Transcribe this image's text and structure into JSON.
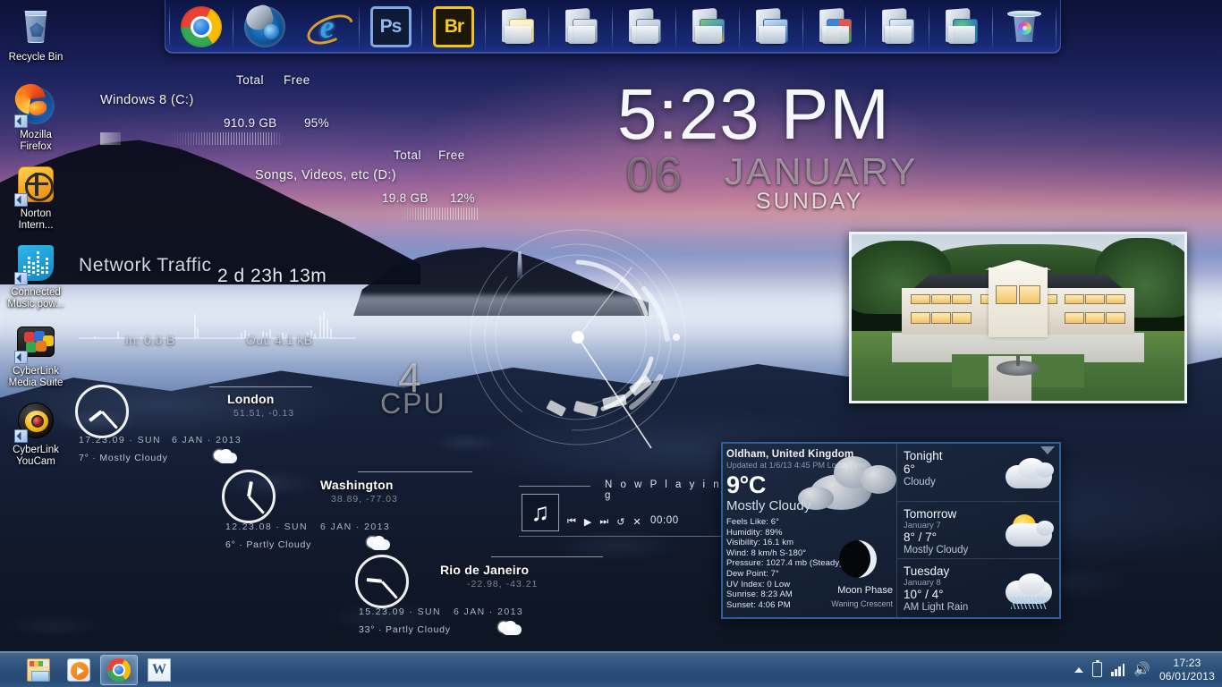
{
  "desktop_icons": [
    {
      "name": "recycle-bin",
      "label": "Recycle Bin"
    },
    {
      "name": "mozilla-firefox",
      "label": "Mozilla\nFirefox"
    },
    {
      "name": "norton-internet",
      "label": "Norton\nIntern..."
    },
    {
      "name": "connected-music",
      "label": "Connected\nMusic pow..."
    },
    {
      "name": "cyberlink-media",
      "label": "CyberLink\nMedia Suite"
    },
    {
      "name": "cyberlink-youcam",
      "label": "CyberLink\nYouCam"
    }
  ],
  "dock": {
    "items": [
      {
        "name": "google-chrome",
        "icon": "chrome-icon"
      },
      {
        "name": "media-player",
        "icon": "dragon-icon"
      },
      {
        "name": "internet-explorer",
        "icon": "ie-icon",
        "label": "e"
      },
      {
        "name": "adobe-photoshop",
        "icon": "photoshop-icon",
        "label": "Ps"
      },
      {
        "name": "adobe-bridge",
        "icon": "bridge-icon",
        "label": "Br"
      },
      {
        "name": "documents-folder",
        "icon": "folder-documents-icon"
      },
      {
        "name": "printers-folder",
        "icon": "folder-printers-icon"
      },
      {
        "name": "devices-folder",
        "icon": "folder-devices-icon"
      },
      {
        "name": "pictures-folder",
        "icon": "folder-pictures-icon"
      },
      {
        "name": "computer-folder",
        "icon": "folder-computer-icon"
      },
      {
        "name": "programs-folder",
        "icon": "folder-programs-icon"
      },
      {
        "name": "control-panel-folder",
        "icon": "folder-controlpanel-icon"
      },
      {
        "name": "network-folder",
        "icon": "folder-network-icon"
      },
      {
        "name": "recycle-bin-dock",
        "icon": "recycle-bin-icon"
      }
    ]
  },
  "disks": [
    {
      "name": "disk-c",
      "label": "Windows 8 (C:)",
      "total_header": "Total",
      "free_header": "Free",
      "total": "910.9 GB",
      "free_pct": "95%",
      "fill_percent": 8
    },
    {
      "name": "disk-d",
      "label": "Songs, Videos, etc (D:)",
      "total_header": "Total",
      "free_header": "Free",
      "total": "19.8 GB",
      "free_pct": "12%",
      "fill_percent": 86
    }
  ],
  "network": {
    "title": "Network Traffic",
    "uptime": "2 d 23h 13m",
    "in": "In: 0.0 B",
    "out": "Out: 4.1 kB"
  },
  "clock": {
    "time": "5:23 PM",
    "day": "06",
    "month": "JANUARY",
    "weekday": "SUNDAY"
  },
  "cpu": {
    "cores": "4",
    "label": "CPU"
  },
  "world_clocks": [
    {
      "name": "london",
      "city": "London",
      "coords": "51.51, -0.13",
      "time_line": "17.23.09  ·  SUN",
      "date_line": "6 JAN  ·  2013",
      "condition": "7°  · Mostly Cloudy",
      "hour_angle": 232,
      "minute_angle": 138
    },
    {
      "name": "washington",
      "city": "Washington",
      "coords": "38.89, -77.03",
      "time_line": "12.23.08  ·  SUN",
      "date_line": "6 JAN  ·  2013",
      "condition": "6°  · Partly Cloudy",
      "hour_angle": 10,
      "minute_angle": 138
    },
    {
      "name": "rio-de-janeiro",
      "city": "Rio de Janeiro",
      "coords": "-22.98, -43.21",
      "time_line": "15.23.09  ·  SUN",
      "date_line": "6 JAN  ·  2013",
      "condition": "33°  · Partly Cloudy",
      "hour_angle": 276,
      "minute_angle": 138
    }
  ],
  "now_playing": {
    "title": "N o w   P l a y i n g",
    "artwork_glyph": "♫",
    "time": "00:00",
    "controls": [
      {
        "name": "previous-button",
        "glyph": "⏮"
      },
      {
        "name": "play-button",
        "glyph": "▶"
      },
      {
        "name": "next-button",
        "glyph": "⏭"
      },
      {
        "name": "repeat-button",
        "glyph": "↺"
      },
      {
        "name": "shuffle-button",
        "glyph": "✕"
      }
    ]
  },
  "weather": {
    "city": "Oldham, United Kingdom",
    "updated": "Updated at 1/6/13 4:45 PM Local Time",
    "temperature": "9°C",
    "condition": "Mostly Cloudy",
    "details": [
      "Feels Like: 6°",
      "Humidity: 89%",
      "Visibility: 16.1 km",
      "Wind: 8 km/h S-180°",
      "Pressure: 1027.4 mb (Steady)",
      "Dew Point: 7°",
      "UV Index: 0 Low",
      "Sunrise: 8:23 AM",
      "Sunset: 4:06 PM"
    ],
    "moon_label": "Moon Phase",
    "moon_phase": "Waning Crescent",
    "forecast": [
      {
        "name": "tonight",
        "title": "Tonight",
        "date": "",
        "temps": "6°",
        "condition": "Cloudy",
        "icon": "cloudy-icon"
      },
      {
        "name": "tomorrow",
        "title": "Tomorrow",
        "date": "January 7",
        "temps": "8° / 7°",
        "condition": "Mostly Cloudy",
        "icon": "partly-sunny-icon"
      },
      {
        "name": "tuesday",
        "title": "Tuesday",
        "date": "January 8",
        "temps": "10° / 4°",
        "condition": "AM Light Rain",
        "icon": "rain-icon"
      }
    ]
  },
  "taskbar": {
    "items": [
      {
        "name": "file-explorer",
        "icon": "explorer-icon",
        "active": false
      },
      {
        "name": "windows-media-player",
        "icon": "wmp-icon",
        "active": false
      },
      {
        "name": "google-chrome",
        "icon": "chrome-icon",
        "active": true
      },
      {
        "name": "microsoft-word",
        "icon": "word-icon",
        "active": false,
        "label": "W"
      }
    ],
    "tray": {
      "time": "17:23",
      "date": "06/01/2013",
      "battery_icon": "battery-icon",
      "signal_icon": "signal-bars-icon",
      "volume_icon": "volume-icon",
      "volume_glyph": "🔊",
      "arrow_icon": "show-hidden-icons-arrow"
    }
  },
  "colors": {
    "dock_bg": "#141c54",
    "weather_border": "#2f5f9e",
    "taskbar": "#34608f"
  }
}
